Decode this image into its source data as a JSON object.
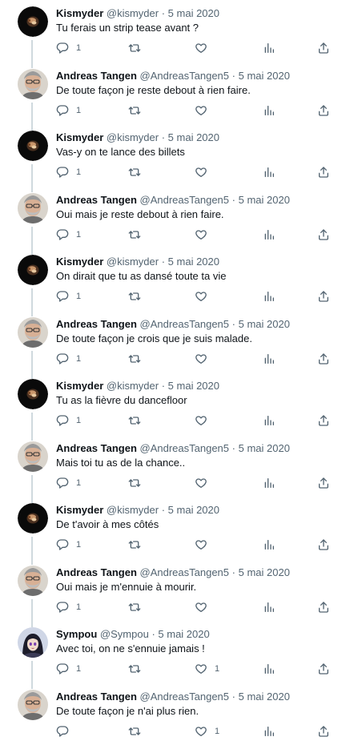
{
  "actions": {
    "reply_icon": "reply-icon",
    "retweet_icon": "retweet-icon",
    "like_icon": "like-icon",
    "views_icon": "views-icon",
    "share_icon": "share-icon"
  },
  "colors": {
    "text": "#0f1419",
    "secondary": "#536471",
    "thread_line": "#cfd9de"
  },
  "tweets": [
    {
      "author": "Kismyder",
      "handle": "@kismyder",
      "sep": "·",
      "date": "5 mai 2020",
      "text": "Tu ferais un strip tease avant ?",
      "reply_count": "1",
      "like_count": "",
      "avatar": "kismyder"
    },
    {
      "author": "Andreas Tangen",
      "handle": "@AndreasTangen5",
      "sep": "·",
      "date": "5 mai 2020",
      "text": "De toute façon je reste debout à rien faire.",
      "reply_count": "1",
      "like_count": "",
      "avatar": "andreas"
    },
    {
      "author": "Kismyder",
      "handle": "@kismyder",
      "sep": "·",
      "date": "5 mai 2020",
      "text": "Vas-y on te lance des billets",
      "reply_count": "1",
      "like_count": "",
      "avatar": "kismyder"
    },
    {
      "author": "Andreas Tangen",
      "handle": "@AndreasTangen5",
      "sep": "·",
      "date": "5 mai 2020",
      "text": "Oui mais je reste debout à rien faire.",
      "reply_count": "1",
      "like_count": "",
      "avatar": "andreas"
    },
    {
      "author": "Kismyder",
      "handle": "@kismyder",
      "sep": "·",
      "date": "5 mai 2020",
      "text": "On dirait que tu as dansé toute ta vie",
      "reply_count": "1",
      "like_count": "",
      "avatar": "kismyder"
    },
    {
      "author": "Andreas Tangen",
      "handle": "@AndreasTangen5",
      "sep": "·",
      "date": "5 mai 2020",
      "text": "De toute façon je crois que je suis malade.",
      "reply_count": "1",
      "like_count": "",
      "avatar": "andreas"
    },
    {
      "author": "Kismyder",
      "handle": "@kismyder",
      "sep": "·",
      "date": "5 mai 2020",
      "text": "Tu as la fièvre du dancefloor",
      "reply_count": "1",
      "like_count": "",
      "avatar": "kismyder"
    },
    {
      "author": "Andreas Tangen",
      "handle": "@AndreasTangen5",
      "sep": "·",
      "date": "5 mai 2020",
      "text": "Mais toi tu as de la chance..",
      "reply_count": "1",
      "like_count": "",
      "avatar": "andreas"
    },
    {
      "author": "Kismyder",
      "handle": "@kismyder",
      "sep": "·",
      "date": "5 mai 2020",
      "text": "De t'avoir à mes côtés",
      "reply_count": "1",
      "like_count": "",
      "avatar": "kismyder"
    },
    {
      "author": "Andreas Tangen",
      "handle": "@AndreasTangen5",
      "sep": "·",
      "date": "5 mai 2020",
      "text": "Oui mais je m'ennuie à mourir.",
      "reply_count": "1",
      "like_count": "",
      "avatar": "andreas"
    },
    {
      "author": "Sympou",
      "handle": "@Sympou",
      "sep": "·",
      "date": "5 mai 2020",
      "text": "Avec toi, on ne s'ennuie jamais !",
      "reply_count": "1",
      "like_count": "1",
      "avatar": "sympou"
    },
    {
      "author": "Andreas Tangen",
      "handle": "@AndreasTangen5",
      "sep": "·",
      "date": "5 mai 2020",
      "text": "De toute façon je n'ai plus rien.",
      "reply_count": "",
      "like_count": "1",
      "avatar": "andreas"
    }
  ]
}
